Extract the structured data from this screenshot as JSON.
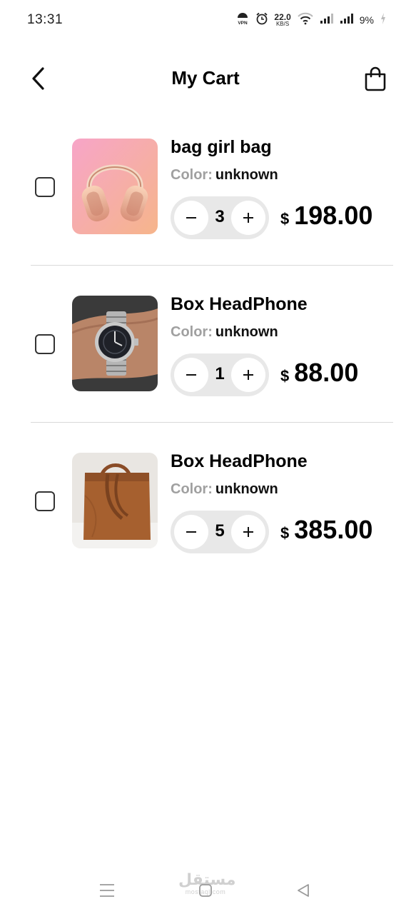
{
  "status_bar": {
    "time": "13:31",
    "net_speed_value": "22.0",
    "net_speed_unit": "KB/S",
    "battery": "9%",
    "icons": [
      "vpn-icon",
      "alarm-icon",
      "wifi-icon",
      "signal-icon",
      "signal-icon",
      "charging-icon"
    ]
  },
  "header": {
    "title": "My Cart",
    "back_icon": "chevron-left-icon",
    "bag_icon": "shopping-bag-icon"
  },
  "cart": {
    "color_label": "Color:",
    "currency": "$",
    "items": [
      {
        "name": "bag girl bag",
        "color": "unknown",
        "quantity": "3",
        "price": "198.00",
        "image": "headphones-image",
        "checked": false
      },
      {
        "name": "Box HeadPhone",
        "color": "unknown",
        "quantity": "1",
        "price": "88.00",
        "image": "wristwatch-image",
        "checked": false
      },
      {
        "name": "Box HeadPhone",
        "color": "unknown",
        "quantity": "5",
        "price": "385.00",
        "image": "leather-bag-image",
        "checked": false
      }
    ]
  },
  "nav_bar": {
    "icons": [
      "menu-icon",
      "home-icon",
      "back-icon"
    ],
    "watermark_arabic": "مستقل",
    "watermark_latin": "mostaql.com"
  },
  "colors": {
    "background": "#ffffff",
    "stepper_bg": "#e8e8e8",
    "muted_text": "#a0a0a0",
    "divider": "#d9d9d9"
  }
}
